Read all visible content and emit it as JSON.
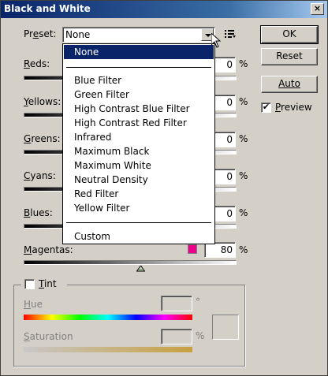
{
  "window": {
    "title": "Black and White",
    "close_glyph": "×"
  },
  "preset": {
    "label_prefix": "Pr",
    "label_underlined": "e",
    "label_suffix": "set:",
    "value": "None"
  },
  "dropdown": {
    "items": [
      "None",
      "Blue Filter",
      "Green Filter",
      "High Contrast Blue Filter",
      "High Contrast Red Filter",
      "Infrared",
      "Maximum Black",
      "Maximum White",
      "Neutral Density",
      "Red Filter",
      "Yellow Filter",
      "Custom"
    ]
  },
  "buttons": {
    "ok": "OK",
    "reset": "Reset",
    "auto": "Auto"
  },
  "preview": {
    "label_underlined": "P",
    "label_rest": "review",
    "checked": true,
    "check_glyph": "✔"
  },
  "sliders": {
    "reds": {
      "label_underlined": "R",
      "label_rest": "eds:",
      "value": "0",
      "unit": "%"
    },
    "yellows": {
      "label_underlined": "Y",
      "label_rest": "ellows:",
      "value": "0",
      "unit": "%"
    },
    "greens": {
      "label_underlined": "G",
      "label_rest": "reens:",
      "value": "0",
      "unit": "%"
    },
    "cyans": {
      "label_underlined": "C",
      "label_rest": "yans:",
      "value": "0",
      "unit": "%"
    },
    "blues": {
      "label_underlined": "B",
      "label_rest": "lues:",
      "value": "0",
      "unit": "%"
    },
    "magentas": {
      "label_underlined": "M",
      "label_rest": "agentas:",
      "value": "80",
      "unit": "%",
      "level": 0.55
    }
  },
  "swatch_color": "#ec008c",
  "tint": {
    "label_underlined": "T",
    "label_rest": "int",
    "checked": false,
    "hue": {
      "label_underlined": "H",
      "label_rest": "ue",
      "value": "",
      "unit": "°"
    },
    "saturation": {
      "label_underlined": "S",
      "label_rest": "aturation",
      "value": "",
      "unit": "%"
    }
  }
}
